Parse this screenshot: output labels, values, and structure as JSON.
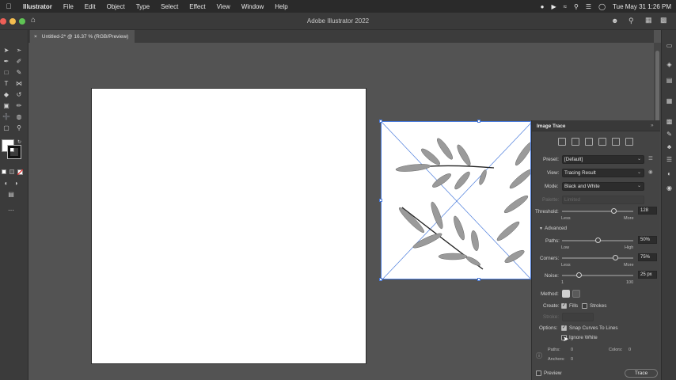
{
  "menubar": {
    "app_name": "Illustrator",
    "menus": [
      "File",
      "Edit",
      "Object",
      "Type",
      "Select",
      "Effect",
      "View",
      "Window",
      "Help"
    ],
    "clock": "Tue May 31  1:26 PM"
  },
  "window": {
    "title": "Adobe Illustrator 2022"
  },
  "document_tab": {
    "label": "Untitled-2* @ 16.37 % (RGB/Preview)",
    "close_glyph": "×"
  },
  "image_trace": {
    "title": "Image Trace",
    "preset_label": "Preset:",
    "preset_value": "[Default]",
    "view_label": "View:",
    "view_value": "Tracing Result",
    "mode_label": "Mode:",
    "mode_value": "Black and White",
    "palette_label": "Palette:",
    "palette_value": "Limited",
    "threshold_label": "Threshold:",
    "threshold_value": "128",
    "threshold_less": "Less",
    "threshold_more": "More",
    "threshold_fraction": 0.73,
    "advanced_label": "Advanced",
    "paths_label": "Paths:",
    "paths_value": "50%",
    "paths_low": "Low",
    "paths_high": "High",
    "paths_fraction": 0.5,
    "corners_label": "Corners:",
    "corners_value": "75%",
    "corners_less": "Less",
    "corners_more": "More",
    "corners_fraction": 0.75,
    "noise_label": "Noise:",
    "noise_value": "25 px",
    "noise_min": "1",
    "noise_max": "100",
    "noise_fraction": 0.24,
    "method_label": "Method:",
    "create_label": "Create:",
    "fills_label": "Fills",
    "fills_checked": true,
    "strokes_label": "Strokes",
    "strokes_checked": false,
    "stroke_label": "Stroke:",
    "options_label": "Options:",
    "snap_label": "Snap Curves To Lines",
    "snap_checked": true,
    "ignore_white_label": "Ignore White",
    "ignore_white_checked": false,
    "stats_paths_label": "Paths:",
    "stats_paths_value": "0",
    "stats_colors_label": "Colors:",
    "stats_colors_value": "0",
    "stats_anchors_label": "Anchors:",
    "stats_anchors_value": "0",
    "preview_label": "Preview",
    "preview_checked": false,
    "trace_button": "Trace"
  },
  "colors": {
    "menubar_bg": "#2a2a2a",
    "workspace": "#535353",
    "panel_bg": "#444444",
    "selection_blue": "#4a7bdc"
  }
}
